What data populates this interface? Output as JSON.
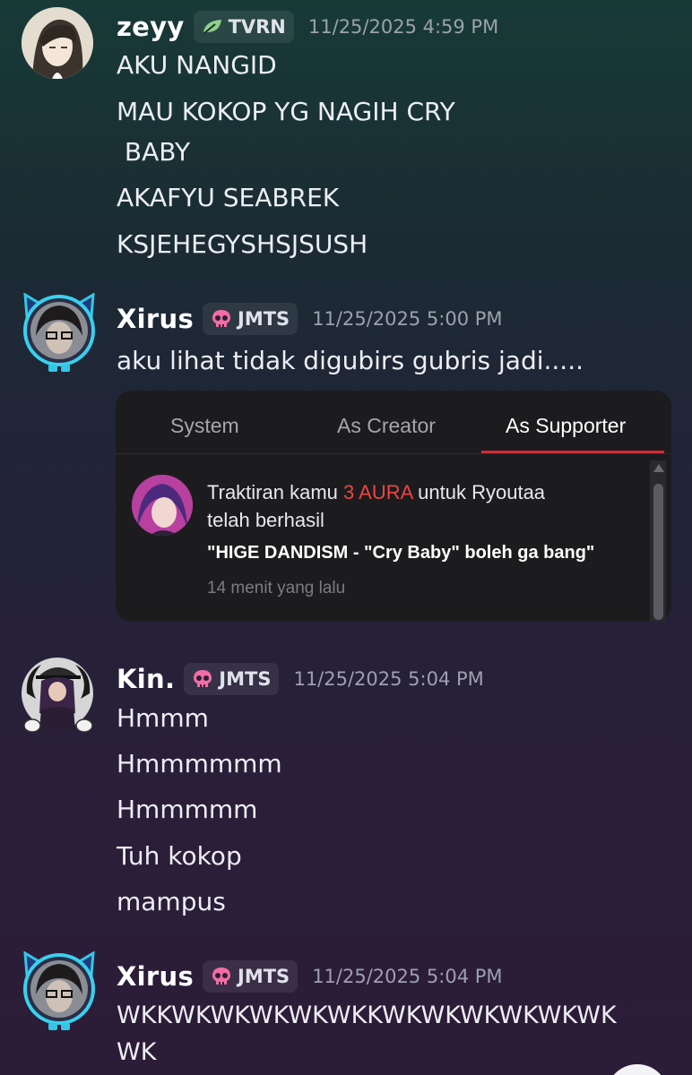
{
  "messages": [
    {
      "username": "zeyy",
      "tag": "TVRN",
      "tag_icon": "leaf-icon",
      "timestamp": "11/25/2025 4:59 PM",
      "lines": [
        "AKU NANGID",
        "MAU KOKOP YG NAGIH CRY",
        " BABY",
        "AKAFYU SEABREK",
        "KSJEHEGYSHSJSUSH"
      ]
    },
    {
      "username": "Xirus",
      "tag": "JMTS",
      "tag_icon": "skull-icon",
      "timestamp": "11/25/2025 5:00 PM",
      "lines": [
        "aku lihat tidak digubirs gubris jadi....."
      ]
    },
    {
      "username": "Kin.",
      "tag": "JMTS",
      "tag_icon": "skull-icon",
      "timestamp": "11/25/2025 5:04 PM",
      "lines": [
        "Hmmm",
        "Hmmmmmm",
        "Hmmmmm",
        "Tuh kokop",
        "mampus"
      ]
    },
    {
      "username": "Xirus",
      "tag": "JMTS",
      "tag_icon": "skull-icon",
      "timestamp": "11/25/2025 5:04 PM",
      "lines": [
        "WKKWKWKWKWKWKKWKWKWKWKWKWK",
        "WK"
      ]
    }
  ],
  "attachment": {
    "tabs": [
      "System",
      "As Creator",
      "As Supporter"
    ],
    "active_tab": "As Supporter",
    "notification": {
      "text_before": "Traktiran kamu ",
      "amount": "3 AURA",
      "text_after": " untuk Ryoutaa",
      "line2": "telah berhasil",
      "message": "\"HIGE DANDISM - \"Cry Baby\" boleh ga bang\"",
      "time": "14 menit yang lalu"
    }
  },
  "colors": {
    "accent_red": "#d42a37",
    "amount_red": "#ef4444",
    "tvrn_icon": "#8fd08a",
    "jmts_icon": "#f26ca7"
  }
}
